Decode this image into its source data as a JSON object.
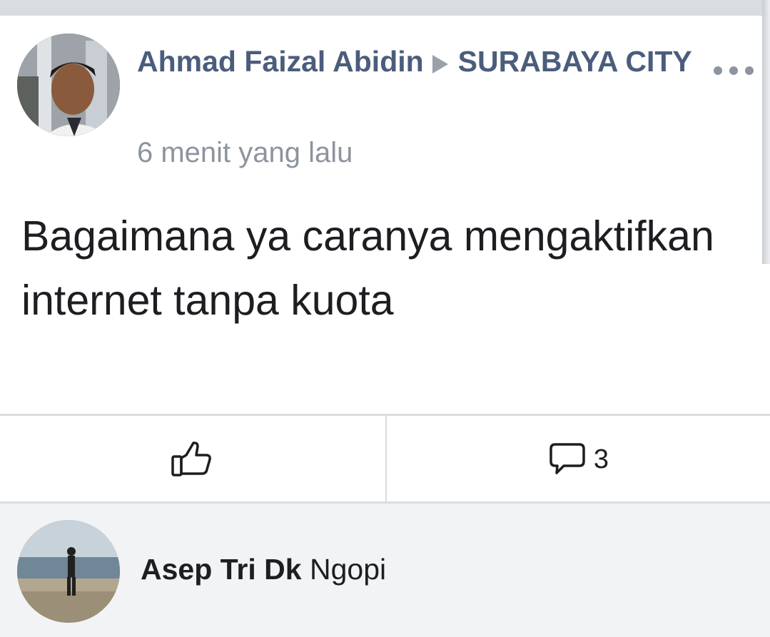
{
  "post": {
    "author": "Ahmad Faizal Abidin",
    "group": "SURABAYA CITY",
    "timestamp": "6 menit yang lalu",
    "text": "Bagaimana ya caranya mengaktifkan internet tanpa kuota",
    "more_icon": "more-horizontal-icon"
  },
  "actions": {
    "like_icon": "thumbs-up-icon",
    "comment_icon": "comment-bubble-icon",
    "comment_count": "3"
  },
  "comment": {
    "author": "Asep Tri Dk",
    "text": "Ngopi"
  },
  "colors": {
    "author_link": "#4b5d7c",
    "meta_gray": "#8d949e",
    "text": "#1c1e21",
    "divider": "#dadde1",
    "comment_bg": "#f2f3f5"
  }
}
